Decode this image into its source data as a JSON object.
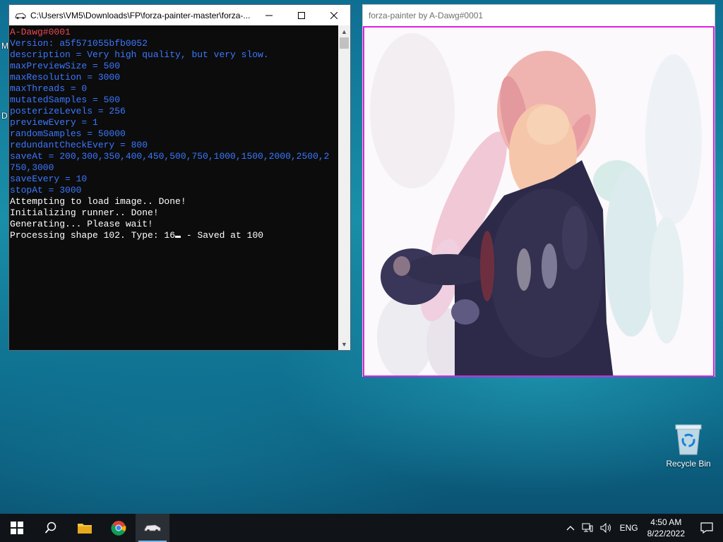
{
  "desktop": {
    "edge_fragments": [
      "M",
      "D"
    ],
    "recycle_bin_label": "Recycle Bin"
  },
  "console_window": {
    "title": "C:\\Users\\VM5\\Downloads\\FP\\forza-painter-master\\forza-...",
    "lines": [
      {
        "text": "A-Dawg#0001",
        "color": "red"
      },
      {
        "text": "Version: a5f571055bfb0052",
        "color": "blue"
      },
      {
        "text": "description = Very high quality, but very slow.",
        "color": "blue"
      },
      {
        "text": "maxPreviewSize = 500",
        "color": "blue"
      },
      {
        "text": "maxResolution = 3000",
        "color": "blue"
      },
      {
        "text": "maxThreads = 0",
        "color": "blue"
      },
      {
        "text": "mutatedSamples = 500",
        "color": "blue"
      },
      {
        "text": "posterizeLevels = 256",
        "color": "blue"
      },
      {
        "text": "previewEvery = 1",
        "color": "blue"
      },
      {
        "text": "randomSamples = 50000",
        "color": "blue"
      },
      {
        "text": "redundantCheckEvery = 800",
        "color": "blue"
      },
      {
        "text": "saveAt = 200,300,350,400,450,500,750,1000,1500,2000,2500,2",
        "color": "blue"
      },
      {
        "text": "750,3000",
        "color": "blue"
      },
      {
        "text": "saveEvery = 10",
        "color": "blue"
      },
      {
        "text": "stopAt = 3000",
        "color": "blue"
      },
      {
        "text": "Attempting to load image.. Done!",
        "color": "white"
      },
      {
        "text": "Initializing runner.. Done!",
        "color": "white"
      },
      {
        "text": "Generating... Please wait!",
        "color": "white"
      }
    ],
    "processing_line_prefix": "Processing shape 102. Type: 16",
    "processing_line_suffix": " - Saved at 100"
  },
  "painter_window": {
    "title": "forza-painter by A-Dawg#0001"
  },
  "taskbar": {
    "language": "ENG",
    "time": "4:50 AM",
    "date": "8/22/2022"
  },
  "colors": {
    "console_red": "#e74856",
    "console_blue": "#3b78ff",
    "console_white": "#ffffff",
    "accent": "#76b9ed"
  }
}
